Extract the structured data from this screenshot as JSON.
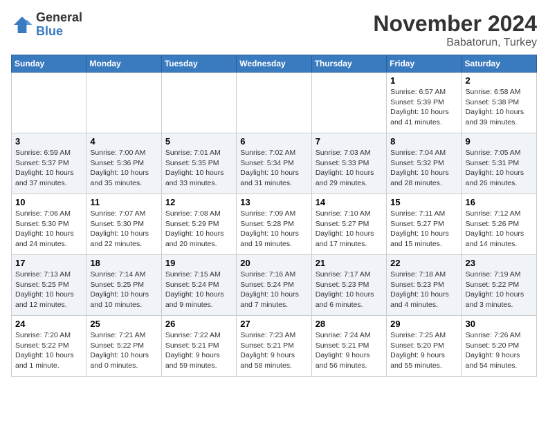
{
  "logo": {
    "general": "General",
    "blue": "Blue"
  },
  "title": "November 2024",
  "location": "Babatorun, Turkey",
  "days_header": [
    "Sunday",
    "Monday",
    "Tuesday",
    "Wednesday",
    "Thursday",
    "Friday",
    "Saturday"
  ],
  "weeks": [
    [
      {
        "day": "",
        "info": ""
      },
      {
        "day": "",
        "info": ""
      },
      {
        "day": "",
        "info": ""
      },
      {
        "day": "",
        "info": ""
      },
      {
        "day": "",
        "info": ""
      },
      {
        "day": "1",
        "info": "Sunrise: 6:57 AM\nSunset: 5:39 PM\nDaylight: 10 hours\nand 41 minutes."
      },
      {
        "day": "2",
        "info": "Sunrise: 6:58 AM\nSunset: 5:38 PM\nDaylight: 10 hours\nand 39 minutes."
      }
    ],
    [
      {
        "day": "3",
        "info": "Sunrise: 6:59 AM\nSunset: 5:37 PM\nDaylight: 10 hours\nand 37 minutes."
      },
      {
        "day": "4",
        "info": "Sunrise: 7:00 AM\nSunset: 5:36 PM\nDaylight: 10 hours\nand 35 minutes."
      },
      {
        "day": "5",
        "info": "Sunrise: 7:01 AM\nSunset: 5:35 PM\nDaylight: 10 hours\nand 33 minutes."
      },
      {
        "day": "6",
        "info": "Sunrise: 7:02 AM\nSunset: 5:34 PM\nDaylight: 10 hours\nand 31 minutes."
      },
      {
        "day": "7",
        "info": "Sunrise: 7:03 AM\nSunset: 5:33 PM\nDaylight: 10 hours\nand 29 minutes."
      },
      {
        "day": "8",
        "info": "Sunrise: 7:04 AM\nSunset: 5:32 PM\nDaylight: 10 hours\nand 28 minutes."
      },
      {
        "day": "9",
        "info": "Sunrise: 7:05 AM\nSunset: 5:31 PM\nDaylight: 10 hours\nand 26 minutes."
      }
    ],
    [
      {
        "day": "10",
        "info": "Sunrise: 7:06 AM\nSunset: 5:30 PM\nDaylight: 10 hours\nand 24 minutes."
      },
      {
        "day": "11",
        "info": "Sunrise: 7:07 AM\nSunset: 5:30 PM\nDaylight: 10 hours\nand 22 minutes."
      },
      {
        "day": "12",
        "info": "Sunrise: 7:08 AM\nSunset: 5:29 PM\nDaylight: 10 hours\nand 20 minutes."
      },
      {
        "day": "13",
        "info": "Sunrise: 7:09 AM\nSunset: 5:28 PM\nDaylight: 10 hours\nand 19 minutes."
      },
      {
        "day": "14",
        "info": "Sunrise: 7:10 AM\nSunset: 5:27 PM\nDaylight: 10 hours\nand 17 minutes."
      },
      {
        "day": "15",
        "info": "Sunrise: 7:11 AM\nSunset: 5:27 PM\nDaylight: 10 hours\nand 15 minutes."
      },
      {
        "day": "16",
        "info": "Sunrise: 7:12 AM\nSunset: 5:26 PM\nDaylight: 10 hours\nand 14 minutes."
      }
    ],
    [
      {
        "day": "17",
        "info": "Sunrise: 7:13 AM\nSunset: 5:25 PM\nDaylight: 10 hours\nand 12 minutes."
      },
      {
        "day": "18",
        "info": "Sunrise: 7:14 AM\nSunset: 5:25 PM\nDaylight: 10 hours\nand 10 minutes."
      },
      {
        "day": "19",
        "info": "Sunrise: 7:15 AM\nSunset: 5:24 PM\nDaylight: 10 hours\nand 9 minutes."
      },
      {
        "day": "20",
        "info": "Sunrise: 7:16 AM\nSunset: 5:24 PM\nDaylight: 10 hours\nand 7 minutes."
      },
      {
        "day": "21",
        "info": "Sunrise: 7:17 AM\nSunset: 5:23 PM\nDaylight: 10 hours\nand 6 minutes."
      },
      {
        "day": "22",
        "info": "Sunrise: 7:18 AM\nSunset: 5:23 PM\nDaylight: 10 hours\nand 4 minutes."
      },
      {
        "day": "23",
        "info": "Sunrise: 7:19 AM\nSunset: 5:22 PM\nDaylight: 10 hours\nand 3 minutes."
      }
    ],
    [
      {
        "day": "24",
        "info": "Sunrise: 7:20 AM\nSunset: 5:22 PM\nDaylight: 10 hours\nand 1 minute."
      },
      {
        "day": "25",
        "info": "Sunrise: 7:21 AM\nSunset: 5:22 PM\nDaylight: 10 hours\nand 0 minutes."
      },
      {
        "day": "26",
        "info": "Sunrise: 7:22 AM\nSunset: 5:21 PM\nDaylight: 9 hours\nand 59 minutes."
      },
      {
        "day": "27",
        "info": "Sunrise: 7:23 AM\nSunset: 5:21 PM\nDaylight: 9 hours\nand 58 minutes."
      },
      {
        "day": "28",
        "info": "Sunrise: 7:24 AM\nSunset: 5:21 PM\nDaylight: 9 hours\nand 56 minutes."
      },
      {
        "day": "29",
        "info": "Sunrise: 7:25 AM\nSunset: 5:20 PM\nDaylight: 9 hours\nand 55 minutes."
      },
      {
        "day": "30",
        "info": "Sunrise: 7:26 AM\nSunset: 5:20 PM\nDaylight: 9 hours\nand 54 minutes."
      }
    ]
  ]
}
